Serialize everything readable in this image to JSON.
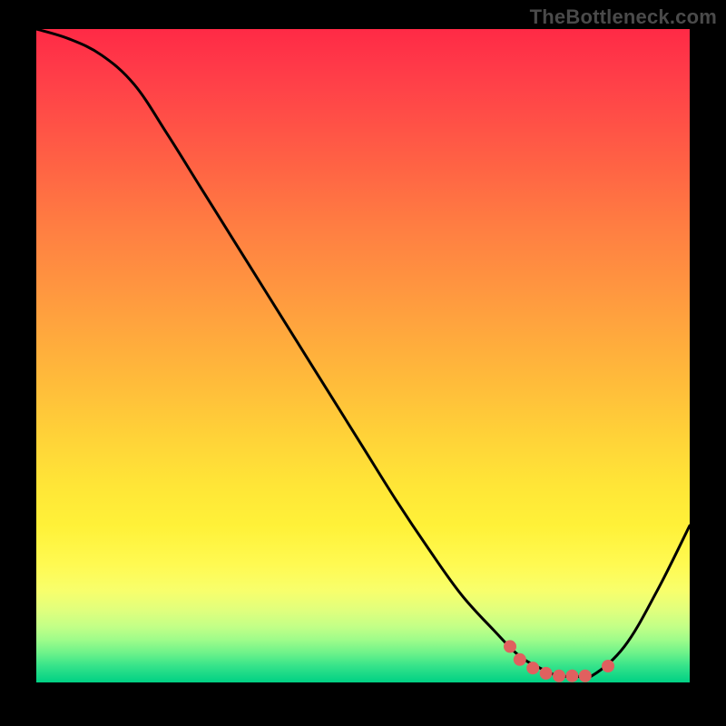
{
  "watermark": "TheBottleneck.com",
  "chart_data": {
    "type": "line",
    "title": "",
    "xlabel": "",
    "ylabel": "",
    "xlim": [
      0,
      100
    ],
    "ylim": [
      0,
      100
    ],
    "grid": false,
    "series": [
      {
        "name": "curve",
        "color": "#000000",
        "x": [
          0,
          5,
          10,
          15,
          20,
          25,
          30,
          35,
          40,
          45,
          50,
          55,
          60,
          65,
          70,
          74,
          77.5,
          80,
          82.5,
          85,
          90,
          95,
          100
        ],
        "values": [
          100,
          98.5,
          96,
          91.5,
          84,
          76,
          68,
          60,
          52,
          44,
          36,
          28,
          20.5,
          13.5,
          8,
          4,
          2,
          1,
          1,
          1,
          5.5,
          14,
          24
        ]
      }
    ],
    "markers": {
      "color": "#e0605f",
      "radius": 7,
      "points": [
        {
          "x": 72.5,
          "y": 5.5
        },
        {
          "x": 74,
          "y": 3.5
        },
        {
          "x": 76,
          "y": 2.2
        },
        {
          "x": 78,
          "y": 1.4
        },
        {
          "x": 80,
          "y": 1.0
        },
        {
          "x": 82,
          "y": 1.0
        },
        {
          "x": 84,
          "y": 1.0
        },
        {
          "x": 87.5,
          "y": 2.5
        }
      ]
    }
  }
}
